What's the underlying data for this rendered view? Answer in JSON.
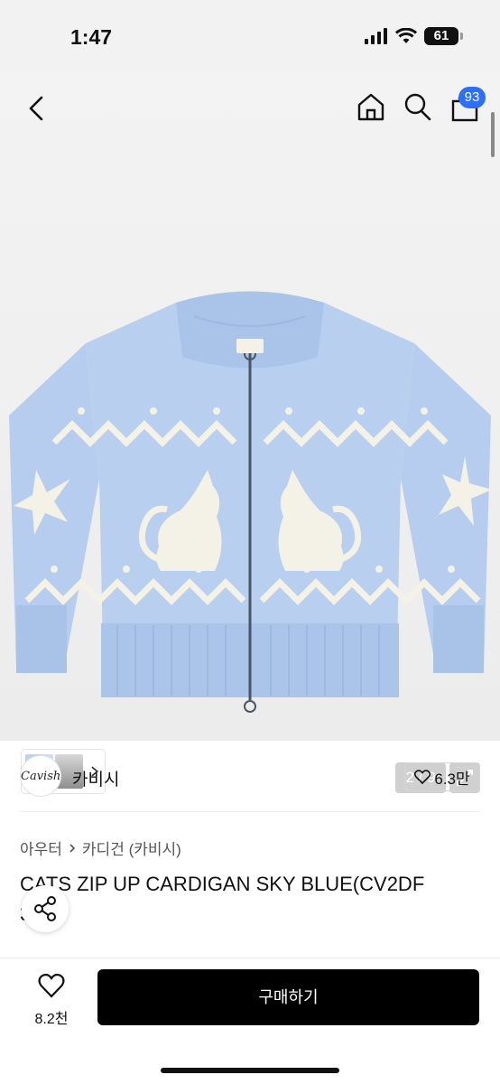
{
  "status_bar": {
    "time": "1:47",
    "battery": "61"
  },
  "header": {
    "back_icon": "chevron-left-icon",
    "home_icon": "home-icon",
    "search_icon": "search-icon",
    "cart_icon": "bag-icon",
    "cart_badge": "93"
  },
  "gallery": {
    "pager": "2 / 9",
    "expand_icon": "expand-icon"
  },
  "brand": {
    "logo_text": "Cavish",
    "name": "카비시",
    "likes": "6.3만"
  },
  "breadcrumb": {
    "category": "아우터",
    "subcategory": "카디건 (카비시)"
  },
  "product": {
    "title": "CATS ZIP UP CARDIGAN SKY BLUE(CV2DF 30A)"
  },
  "bottom_bar": {
    "wish_count": "8.2천",
    "buy_label": "구매하기"
  },
  "colors": {
    "accent": "#2d6ff7",
    "sweater": "#b8cff0",
    "pattern": "#f4f1e6",
    "buy_button": "#000000"
  }
}
